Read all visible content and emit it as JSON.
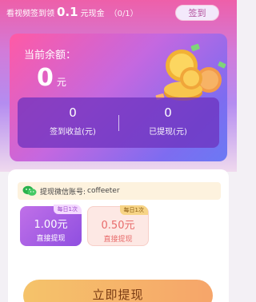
{
  "top": {
    "prefix": "看视频签到领",
    "amount": "0.1",
    "suffix": "元现金",
    "progress": "（0/1）",
    "signin_label": "签到"
  },
  "balance": {
    "label": "当前余额：",
    "value": "0",
    "unit": "元"
  },
  "stats": [
    {
      "value": "0",
      "label": "签到收益(元)"
    },
    {
      "value": "0",
      "label": "已提现(元)"
    }
  ],
  "account": {
    "label": "提现微信账号:",
    "name": "coffeeter"
  },
  "options": [
    {
      "amount": "1.00元",
      "sub": "直接提现",
      "tag": "每日1次"
    },
    {
      "amount": "0.50元",
      "sub": "直接提现",
      "tag": "每日1次"
    }
  ],
  "withdraw_label": "立即提现",
  "colors": {
    "accent_pink": "#ff5aa5",
    "accent_purple": "#7e6cf0",
    "button_gold": "#f5c36a"
  }
}
